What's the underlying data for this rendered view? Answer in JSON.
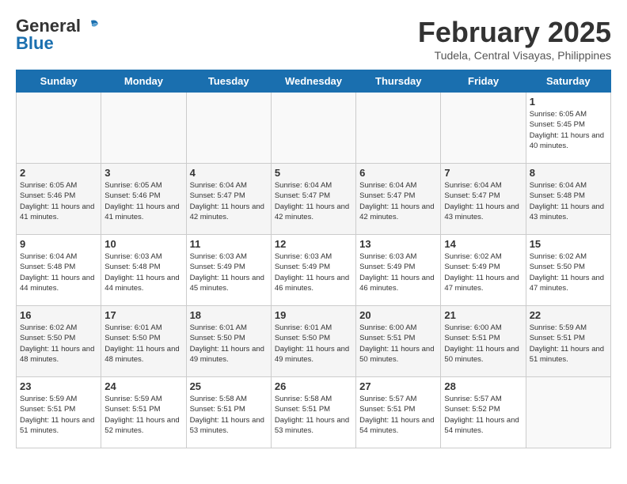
{
  "header": {
    "logo_general": "General",
    "logo_blue": "Blue",
    "title": "February 2025",
    "subtitle": "Tudela, Central Visayas, Philippines"
  },
  "days_of_week": [
    "Sunday",
    "Monday",
    "Tuesday",
    "Wednesday",
    "Thursday",
    "Friday",
    "Saturday"
  ],
  "weeks": [
    [
      {
        "day": "",
        "info": ""
      },
      {
        "day": "",
        "info": ""
      },
      {
        "day": "",
        "info": ""
      },
      {
        "day": "",
        "info": ""
      },
      {
        "day": "",
        "info": ""
      },
      {
        "day": "",
        "info": ""
      },
      {
        "day": "1",
        "info": "Sunrise: 6:05 AM\nSunset: 5:45 PM\nDaylight: 11 hours and 40 minutes."
      }
    ],
    [
      {
        "day": "2",
        "info": "Sunrise: 6:05 AM\nSunset: 5:46 PM\nDaylight: 11 hours and 41 minutes."
      },
      {
        "day": "3",
        "info": "Sunrise: 6:05 AM\nSunset: 5:46 PM\nDaylight: 11 hours and 41 minutes."
      },
      {
        "day": "4",
        "info": "Sunrise: 6:04 AM\nSunset: 5:47 PM\nDaylight: 11 hours and 42 minutes."
      },
      {
        "day": "5",
        "info": "Sunrise: 6:04 AM\nSunset: 5:47 PM\nDaylight: 11 hours and 42 minutes."
      },
      {
        "day": "6",
        "info": "Sunrise: 6:04 AM\nSunset: 5:47 PM\nDaylight: 11 hours and 42 minutes."
      },
      {
        "day": "7",
        "info": "Sunrise: 6:04 AM\nSunset: 5:47 PM\nDaylight: 11 hours and 43 minutes."
      },
      {
        "day": "8",
        "info": "Sunrise: 6:04 AM\nSunset: 5:48 PM\nDaylight: 11 hours and 43 minutes."
      }
    ],
    [
      {
        "day": "9",
        "info": "Sunrise: 6:04 AM\nSunset: 5:48 PM\nDaylight: 11 hours and 44 minutes."
      },
      {
        "day": "10",
        "info": "Sunrise: 6:03 AM\nSunset: 5:48 PM\nDaylight: 11 hours and 44 minutes."
      },
      {
        "day": "11",
        "info": "Sunrise: 6:03 AM\nSunset: 5:49 PM\nDaylight: 11 hours and 45 minutes."
      },
      {
        "day": "12",
        "info": "Sunrise: 6:03 AM\nSunset: 5:49 PM\nDaylight: 11 hours and 46 minutes."
      },
      {
        "day": "13",
        "info": "Sunrise: 6:03 AM\nSunset: 5:49 PM\nDaylight: 11 hours and 46 minutes."
      },
      {
        "day": "14",
        "info": "Sunrise: 6:02 AM\nSunset: 5:49 PM\nDaylight: 11 hours and 47 minutes."
      },
      {
        "day": "15",
        "info": "Sunrise: 6:02 AM\nSunset: 5:50 PM\nDaylight: 11 hours and 47 minutes."
      }
    ],
    [
      {
        "day": "16",
        "info": "Sunrise: 6:02 AM\nSunset: 5:50 PM\nDaylight: 11 hours and 48 minutes."
      },
      {
        "day": "17",
        "info": "Sunrise: 6:01 AM\nSunset: 5:50 PM\nDaylight: 11 hours and 48 minutes."
      },
      {
        "day": "18",
        "info": "Sunrise: 6:01 AM\nSunset: 5:50 PM\nDaylight: 11 hours and 49 minutes."
      },
      {
        "day": "19",
        "info": "Sunrise: 6:01 AM\nSunset: 5:50 PM\nDaylight: 11 hours and 49 minutes."
      },
      {
        "day": "20",
        "info": "Sunrise: 6:00 AM\nSunset: 5:51 PM\nDaylight: 11 hours and 50 minutes."
      },
      {
        "day": "21",
        "info": "Sunrise: 6:00 AM\nSunset: 5:51 PM\nDaylight: 11 hours and 50 minutes."
      },
      {
        "day": "22",
        "info": "Sunrise: 5:59 AM\nSunset: 5:51 PM\nDaylight: 11 hours and 51 minutes."
      }
    ],
    [
      {
        "day": "23",
        "info": "Sunrise: 5:59 AM\nSunset: 5:51 PM\nDaylight: 11 hours and 51 minutes."
      },
      {
        "day": "24",
        "info": "Sunrise: 5:59 AM\nSunset: 5:51 PM\nDaylight: 11 hours and 52 minutes."
      },
      {
        "day": "25",
        "info": "Sunrise: 5:58 AM\nSunset: 5:51 PM\nDaylight: 11 hours and 53 minutes."
      },
      {
        "day": "26",
        "info": "Sunrise: 5:58 AM\nSunset: 5:51 PM\nDaylight: 11 hours and 53 minutes."
      },
      {
        "day": "27",
        "info": "Sunrise: 5:57 AM\nSunset: 5:51 PM\nDaylight: 11 hours and 54 minutes."
      },
      {
        "day": "28",
        "info": "Sunrise: 5:57 AM\nSunset: 5:52 PM\nDaylight: 11 hours and 54 minutes."
      },
      {
        "day": "",
        "info": ""
      }
    ]
  ]
}
